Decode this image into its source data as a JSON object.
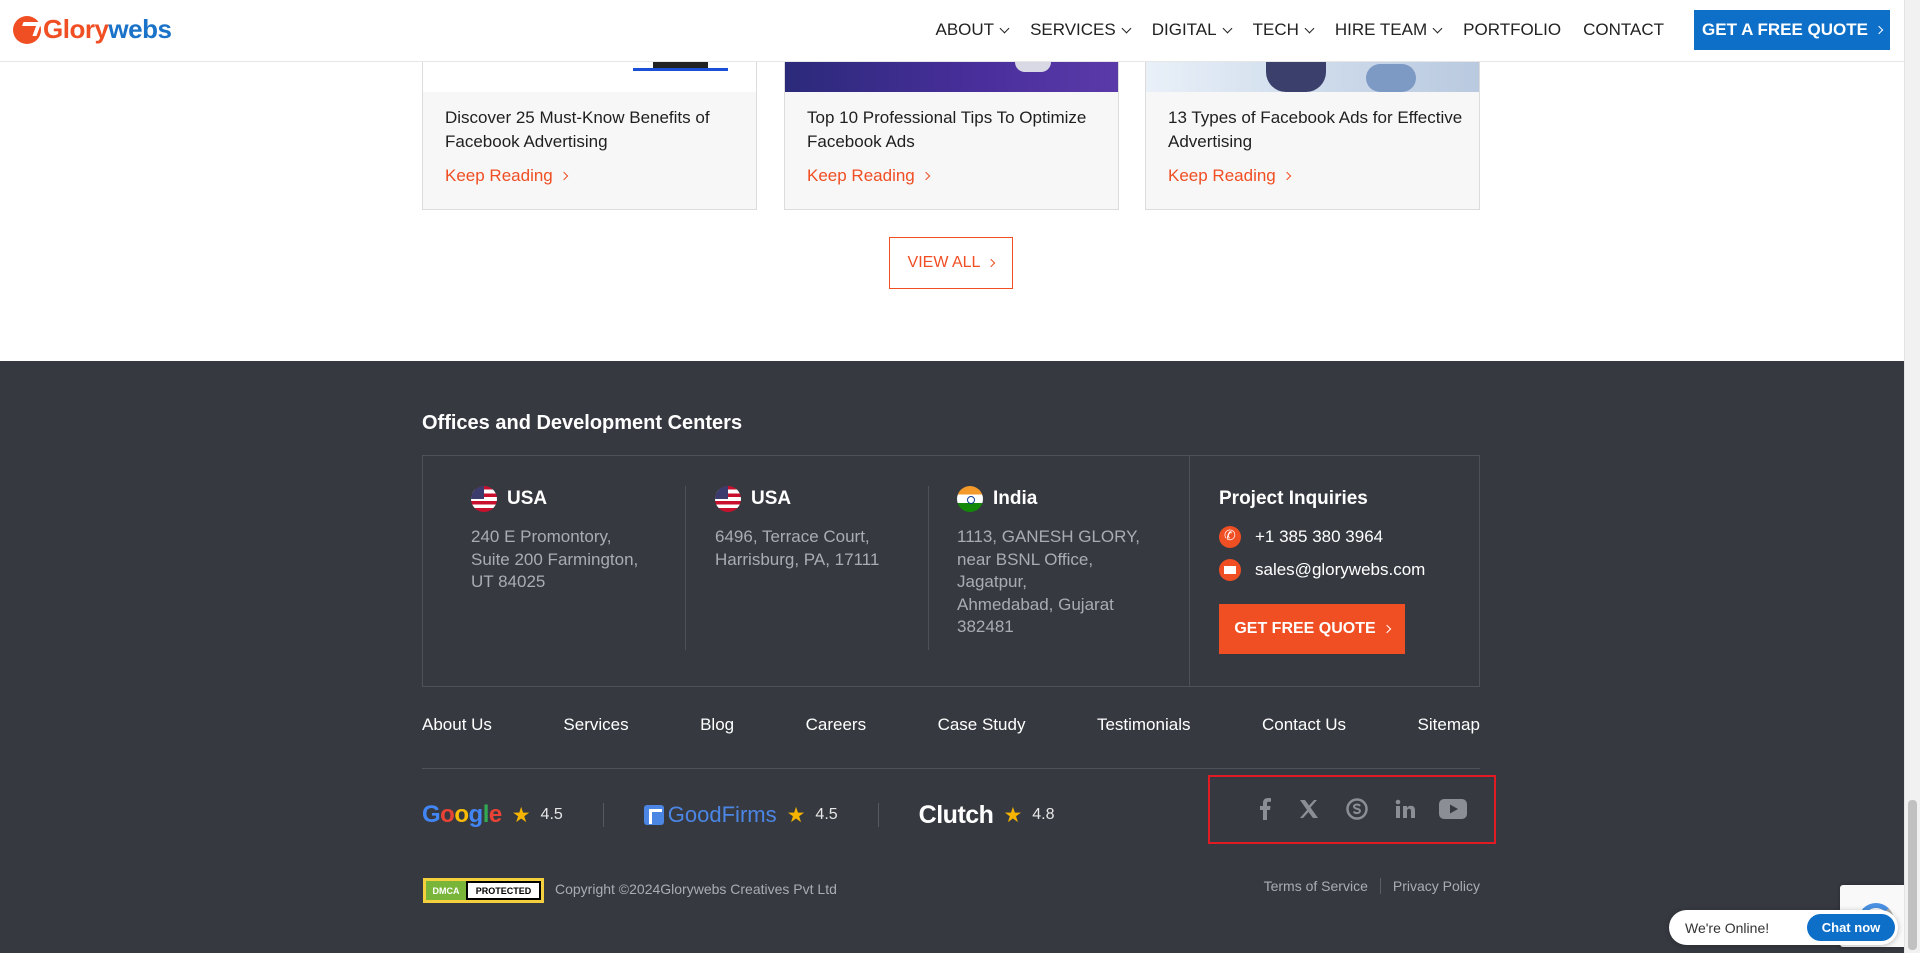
{
  "header": {
    "logo": {
      "part1": "Glory",
      "part2": "webs"
    },
    "nav": [
      {
        "label": "ABOUT",
        "dropdown": true
      },
      {
        "label": "SERVICES",
        "dropdown": true
      },
      {
        "label": "DIGITAL",
        "dropdown": true
      },
      {
        "label": "TECH",
        "dropdown": true
      },
      {
        "label": "HIRE TEAM",
        "dropdown": true
      },
      {
        "label": "PORTFOLIO",
        "dropdown": false
      },
      {
        "label": "CONTACT",
        "dropdown": false
      }
    ],
    "cta": "GET A FREE QUOTE"
  },
  "blog": {
    "cards": [
      {
        "title": "Discover 25 Must-Know Benefits of Facebook Advertising",
        "link": "Keep Reading"
      },
      {
        "title": "Top 10 Professional Tips To Optimize Facebook Ads",
        "link": "Keep Reading"
      },
      {
        "title": "13 Types of Facebook Ads for Effective Advertising",
        "link": "Keep Reading"
      }
    ],
    "view_all": "VIEW ALL"
  },
  "footer": {
    "offices_title": "Offices and Development Centers",
    "offices": [
      {
        "country": "USA",
        "address": "240 E Promontory,\nSuite 200 Farmington,\nUT 84025"
      },
      {
        "country": "USA",
        "address": "6496, Terrace Court,\nHarrisburg, PA, 17111"
      },
      {
        "country": "India",
        "address": "1113, GANESH GLORY,\nnear BSNL Office,\nJagatpur,\nAhmedabad, Gujarat\n382481"
      }
    ],
    "inquiries": {
      "title": "Project Inquiries",
      "phone": "+1 385 380 3964",
      "email": "sales@glorywebs.com",
      "cta": "GET FREE QUOTE"
    },
    "links": [
      "About Us",
      "Services",
      "Blog",
      "Careers",
      "Case Study",
      "Testimonials",
      "Contact Us",
      "Sitemap"
    ],
    "ratings": [
      {
        "brand": "Google",
        "score": "4.5"
      },
      {
        "brand": "GoodFirms",
        "score": "4.5"
      },
      {
        "brand": "Clutch",
        "score": "4.8"
      }
    ],
    "social": [
      "facebook-icon",
      "x-icon",
      "skype-icon",
      "linkedin-icon",
      "youtube-icon"
    ],
    "dmca": {
      "left": "DMCA",
      "right": "PROTECTED"
    },
    "copyright": "Copyright ©2024Glorywebs Creatives Pvt Ltd",
    "legal": [
      "Terms of Service",
      "Privacy Policy"
    ]
  },
  "chat": {
    "status": "We're Online!",
    "button": "Chat now"
  },
  "colors": {
    "accent": "#f04e23",
    "primary": "#0d6fc8",
    "footer_bg": "#363a40",
    "highlight_box": "#e01b24"
  }
}
